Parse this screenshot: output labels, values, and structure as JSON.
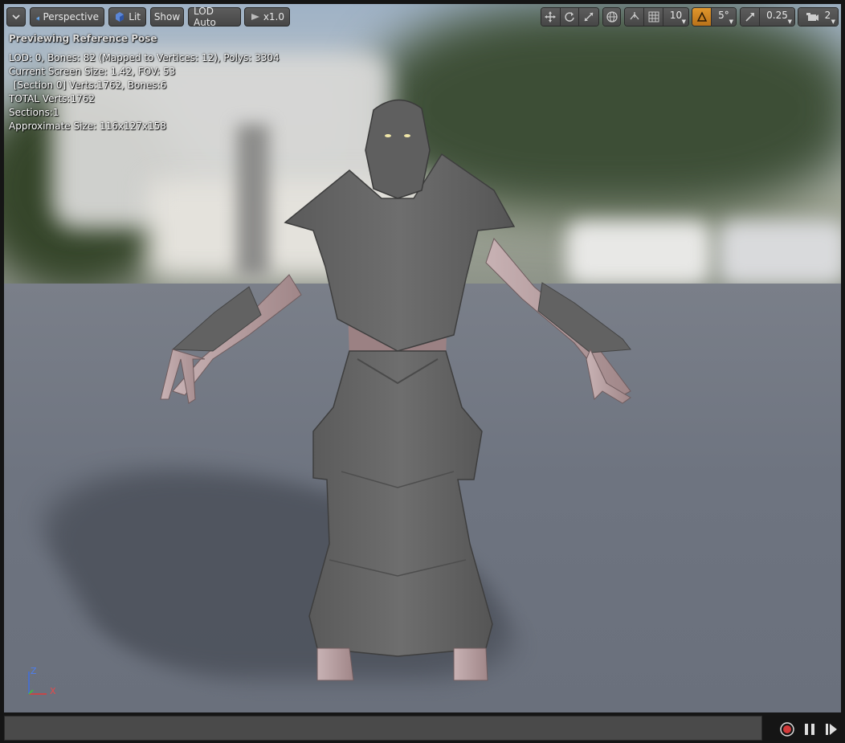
{
  "toolbar": {
    "menu_icon": "chevron-down-icon",
    "perspective_label": "Perspective",
    "lit_label": "Lit",
    "show_label": "Show",
    "lod_label": "LOD Auto",
    "speed_label": "x1.0",
    "grid_snap_value": "10",
    "rotation_snap_value": "5°",
    "scale_snap_value": "0.25",
    "camera_speed_value": "2",
    "accent_color": "#e0962c"
  },
  "overlay": {
    "title": "Previewing Reference Pose",
    "lines": [
      "LOD: 0, Bones: 82 (Mapped to Vertices: 12), Polys: 3304",
      "Current Screen Size: 1.42, FOV: 53",
      " [Section 0] Verts:1762, Bones:6",
      "TOTAL Verts:1762",
      "Sections:1",
      "Approximate Size: 116x127x158"
    ]
  },
  "axis": {
    "z": "Z",
    "x": "X"
  },
  "transport": {
    "record_icon": "record-icon",
    "pause_icon": "pause-icon",
    "step_icon": "step-forward-icon",
    "record_color": "#d23a3a"
  }
}
